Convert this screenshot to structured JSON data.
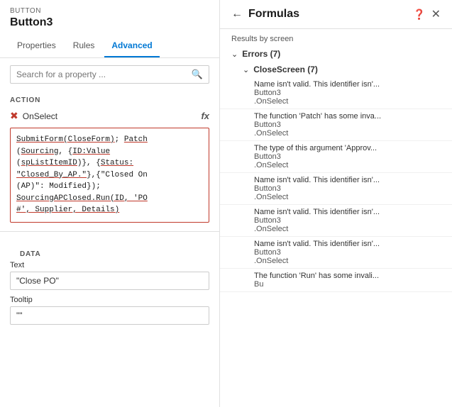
{
  "left": {
    "element_type": "BUTTON",
    "element_name": "Button3",
    "tabs": [
      {
        "label": "Properties",
        "active": false
      },
      {
        "label": "Rules",
        "active": false
      },
      {
        "label": "Advanced",
        "active": true
      }
    ],
    "search_placeholder": "Search for a property ...",
    "action_label": "ACTION",
    "on_select_label": "OnSelect",
    "fx_label": "fx",
    "code": "SubmitForm(CloseForm); Patch(Sourcing, {ID:Value(spListItemID)}, {Status:\"Closed_By_AP.\"},{\"Closed On (AP)\": Modified}); SourcingAPClosed.Run(ID, 'PO #', Supplier, Details)",
    "data_label": "DATA",
    "fields": [
      {
        "label": "Text",
        "value": "\"Close PO\""
      },
      {
        "label": "Tooltip",
        "value": "\"\""
      }
    ]
  },
  "right": {
    "back_label": "←",
    "title": "Formulas",
    "close_label": "✕",
    "help_label": "?",
    "results_label": "Results by screen",
    "groups": [
      {
        "label": "Errors (7)",
        "expanded": true,
        "sub_groups": [
          {
            "label": "CloseScreen (7)",
            "expanded": true,
            "items": [
              {
                "text": "Name isn't valid. This identifier isn'...",
                "element": "Button3",
                "property": ".OnSelect"
              },
              {
                "text": "The function 'Patch' has some inva...",
                "element": "Button3",
                "property": ".OnSelect"
              },
              {
                "text": "The type of this argument 'Approv...",
                "element": "Button3",
                "property": ".OnSelect"
              },
              {
                "text": "Name isn't valid. This identifier isn'...",
                "element": "Button3",
                "property": ".OnSelect"
              },
              {
                "text": "Name isn't valid. This identifier isn'...",
                "element": "Button3",
                "property": ".OnSelect"
              },
              {
                "text": "Name isn't valid. This identifier isn'...",
                "element": "Button3",
                "property": ".OnSelect"
              },
              {
                "text": "The function 'Run' has some invali...",
                "element": "Bu",
                "property": ""
              }
            ]
          }
        ]
      }
    ]
  }
}
